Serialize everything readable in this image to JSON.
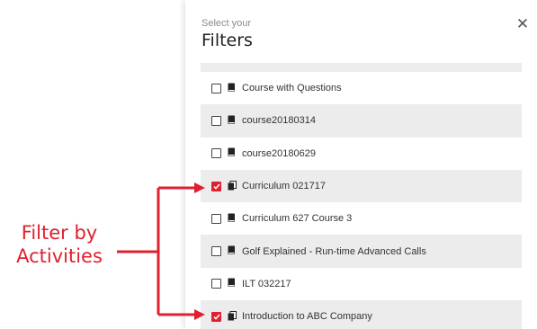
{
  "header": {
    "subtitle": "Select your",
    "title": "Filters"
  },
  "close_icon": "close-icon",
  "items": [
    {
      "label": "Course with Questions",
      "checked": false,
      "icon": "course-icon",
      "shaded": false
    },
    {
      "label": "course20180314",
      "checked": false,
      "icon": "course-icon",
      "shaded": true
    },
    {
      "label": "course20180629",
      "checked": false,
      "icon": "course-icon",
      "shaded": false
    },
    {
      "label": "Curriculum 021717",
      "checked": true,
      "icon": "curriculum-icon",
      "shaded": true
    },
    {
      "label": "Curriculum 627 Course 3",
      "checked": false,
      "icon": "course-icon",
      "shaded": false
    },
    {
      "label": "Golf Explained - Run-time Advanced Calls",
      "checked": false,
      "icon": "course-icon",
      "shaded": true
    },
    {
      "label": "ILT 032217",
      "checked": false,
      "icon": "course-icon",
      "shaded": false
    },
    {
      "label": "Introduction to ABC Company",
      "checked": true,
      "icon": "curriculum-icon",
      "shaded": true
    }
  ],
  "annotation": {
    "line1": "Filter by",
    "line2": "Activities",
    "color": "#e0202f"
  },
  "colors": {
    "accent": "#e0202f",
    "row_shade": "#ececec"
  }
}
